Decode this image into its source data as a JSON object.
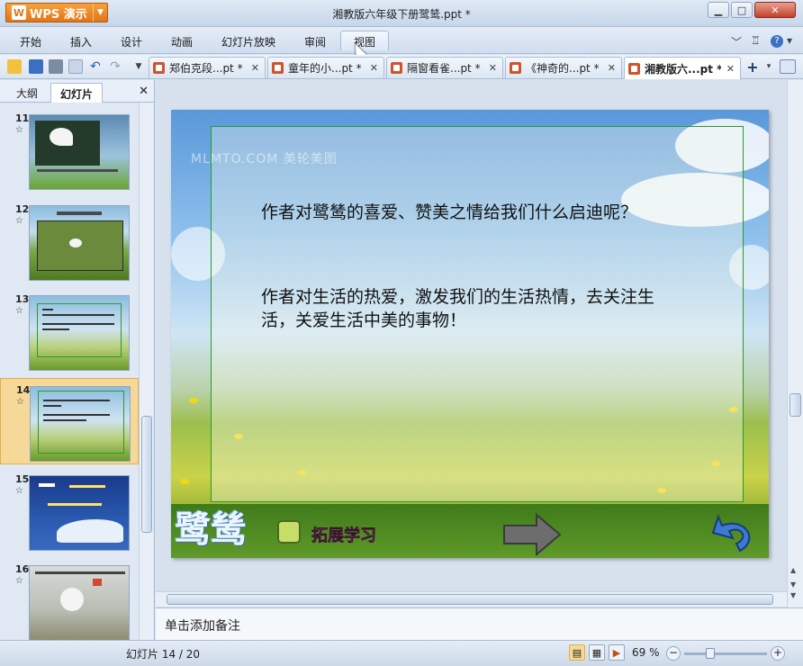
{
  "window": {
    "app_button": "WPS 演示",
    "app_logo": "W",
    "title": "湘教版六年级下册鹭鸶.ppt *"
  },
  "menu": {
    "items": [
      "开始",
      "插入",
      "设计",
      "动画",
      "幻灯片放映",
      "审阅",
      "视图"
    ],
    "active": "视图"
  },
  "tabs": [
    {
      "label": "郑伯克段...pt *"
    },
    {
      "label": "童年的小...pt *"
    },
    {
      "label": "隔窗看雀...pt *"
    },
    {
      "label": "《神奇的...pt *"
    },
    {
      "label": "湘教版六...pt *"
    }
  ],
  "panel": {
    "tab_outline": "大纲",
    "tab_slides": "幻灯片",
    "close": "✕"
  },
  "thumbnails": [
    {
      "num": "11"
    },
    {
      "num": "12"
    },
    {
      "num": "13"
    },
    {
      "num": "14"
    },
    {
      "num": "15"
    },
    {
      "num": "16"
    }
  ],
  "slide": {
    "watermark": "MLMTO.COM  美轮美图",
    "paragraph1": "作者对鹭鸶的喜爱、赞美之情给我们什么启迪呢？",
    "paragraph2": "作者对生活的热爱，激发我们的生活热情，去关注生活，关爱生活中美的事物！",
    "title_art": "鹭鸶",
    "extend_label": "拓展学习"
  },
  "notes": {
    "placeholder": "单击添加备注"
  },
  "status": {
    "slide_counter": "幻灯片 14 / 20",
    "zoom": "69 %"
  },
  "colors": {
    "accent_orange": "#e0761a",
    "selection": "#f6d998",
    "frame_green": "#2a9a2a"
  }
}
